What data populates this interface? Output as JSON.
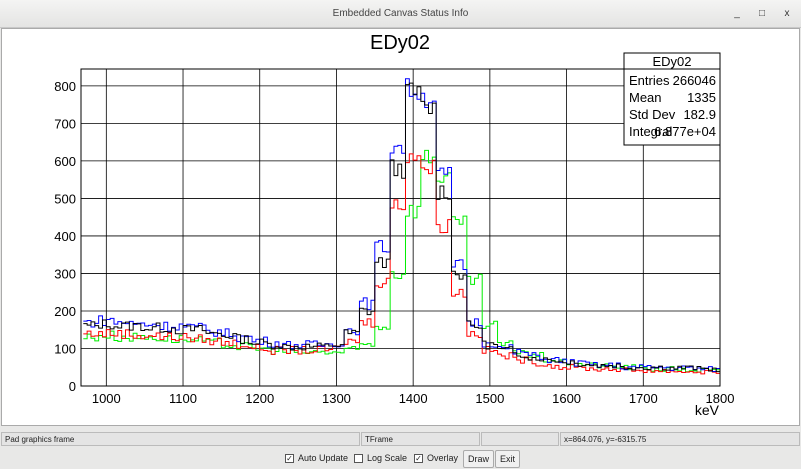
{
  "window": {
    "title": "Embedded Canvas Status Info",
    "minimize": "_",
    "maximize": "□",
    "close": "x"
  },
  "status": {
    "object": "Pad graphics frame",
    "class": "TFrame",
    "empty": "",
    "coords": "x=864.076, y=-6315.75"
  },
  "controls": {
    "auto_update": {
      "label": "Auto Update",
      "checked": true
    },
    "log_scale": {
      "label": "Log Scale",
      "checked": false
    },
    "overlay": {
      "label": "Overlay",
      "checked": true
    },
    "draw": "Draw",
    "exit": "Exit"
  },
  "stats": {
    "title": "EDy02",
    "rows": [
      {
        "k": "Entries",
        "v": "266046"
      },
      {
        "k": "Mean",
        "v": "1335"
      },
      {
        "k": "Std Dev",
        "v": "182.9"
      },
      {
        "k": "Integral",
        "v": "6.877e+04"
      }
    ]
  },
  "chart_data": {
    "type": "line",
    "title": "EDy02",
    "xlabel": "keV",
    "ylabel": "",
    "xlim": [
      967,
      1800
    ],
    "ylim": [
      0,
      845
    ],
    "grid": true,
    "xticks": [
      1000,
      1100,
      1200,
      1300,
      1400,
      1500,
      1600,
      1700,
      1800
    ],
    "yticks": [
      0,
      100,
      200,
      300,
      400,
      500,
      600,
      700,
      800
    ],
    "bin_start": 970,
    "bin_width": 20,
    "series": [
      {
        "name": "black",
        "color": "#000000",
        "values": [
          160,
          165,
          160,
          160,
          155,
          155,
          150,
          150,
          140,
          135,
          125,
          115,
          110,
          105,
          105,
          105,
          110,
          140,
          200,
          330,
          580,
          780,
          740,
          520,
          300,
          160,
          110,
          95,
          85,
          75,
          70,
          65,
          60,
          55,
          55,
          50,
          50,
          50,
          48,
          48,
          45,
          45
        ]
      },
      {
        "name": "blue",
        "color": "#0000ff",
        "values": [
          170,
          175,
          170,
          165,
          165,
          160,
          160,
          155,
          145,
          140,
          130,
          120,
          115,
          110,
          110,
          110,
          115,
          150,
          220,
          370,
          640,
          790,
          770,
          560,
          320,
          170,
          115,
          100,
          90,
          80,
          70,
          65,
          60,
          55,
          55,
          50,
          50,
          50,
          48,
          48,
          45,
          45
        ]
      },
      {
        "name": "red",
        "color": "#ff0000",
        "values": [
          140,
          140,
          140,
          135,
          135,
          130,
          130,
          125,
          120,
          115,
          110,
          100,
          95,
          95,
          95,
          95,
          100,
          120,
          170,
          280,
          480,
          620,
          580,
          430,
          250,
          140,
          95,
          80,
          70,
          62,
          55,
          50,
          48,
          45,
          45,
          42,
          42,
          40,
          40,
          38,
          38,
          38
        ]
      },
      {
        "name": "green",
        "color": "#00ee00",
        "values": [
          130,
          135,
          130,
          130,
          130,
          125,
          125,
          120,
          115,
          110,
          105,
          100,
          95,
          90,
          90,
          90,
          90,
          95,
          110,
          160,
          300,
          470,
          610,
          560,
          430,
          280,
          160,
          110,
          95,
          80,
          70,
          62,
          58,
          55,
          52,
          50,
          48,
          45,
          45,
          42,
          42,
          40
        ]
      }
    ]
  }
}
